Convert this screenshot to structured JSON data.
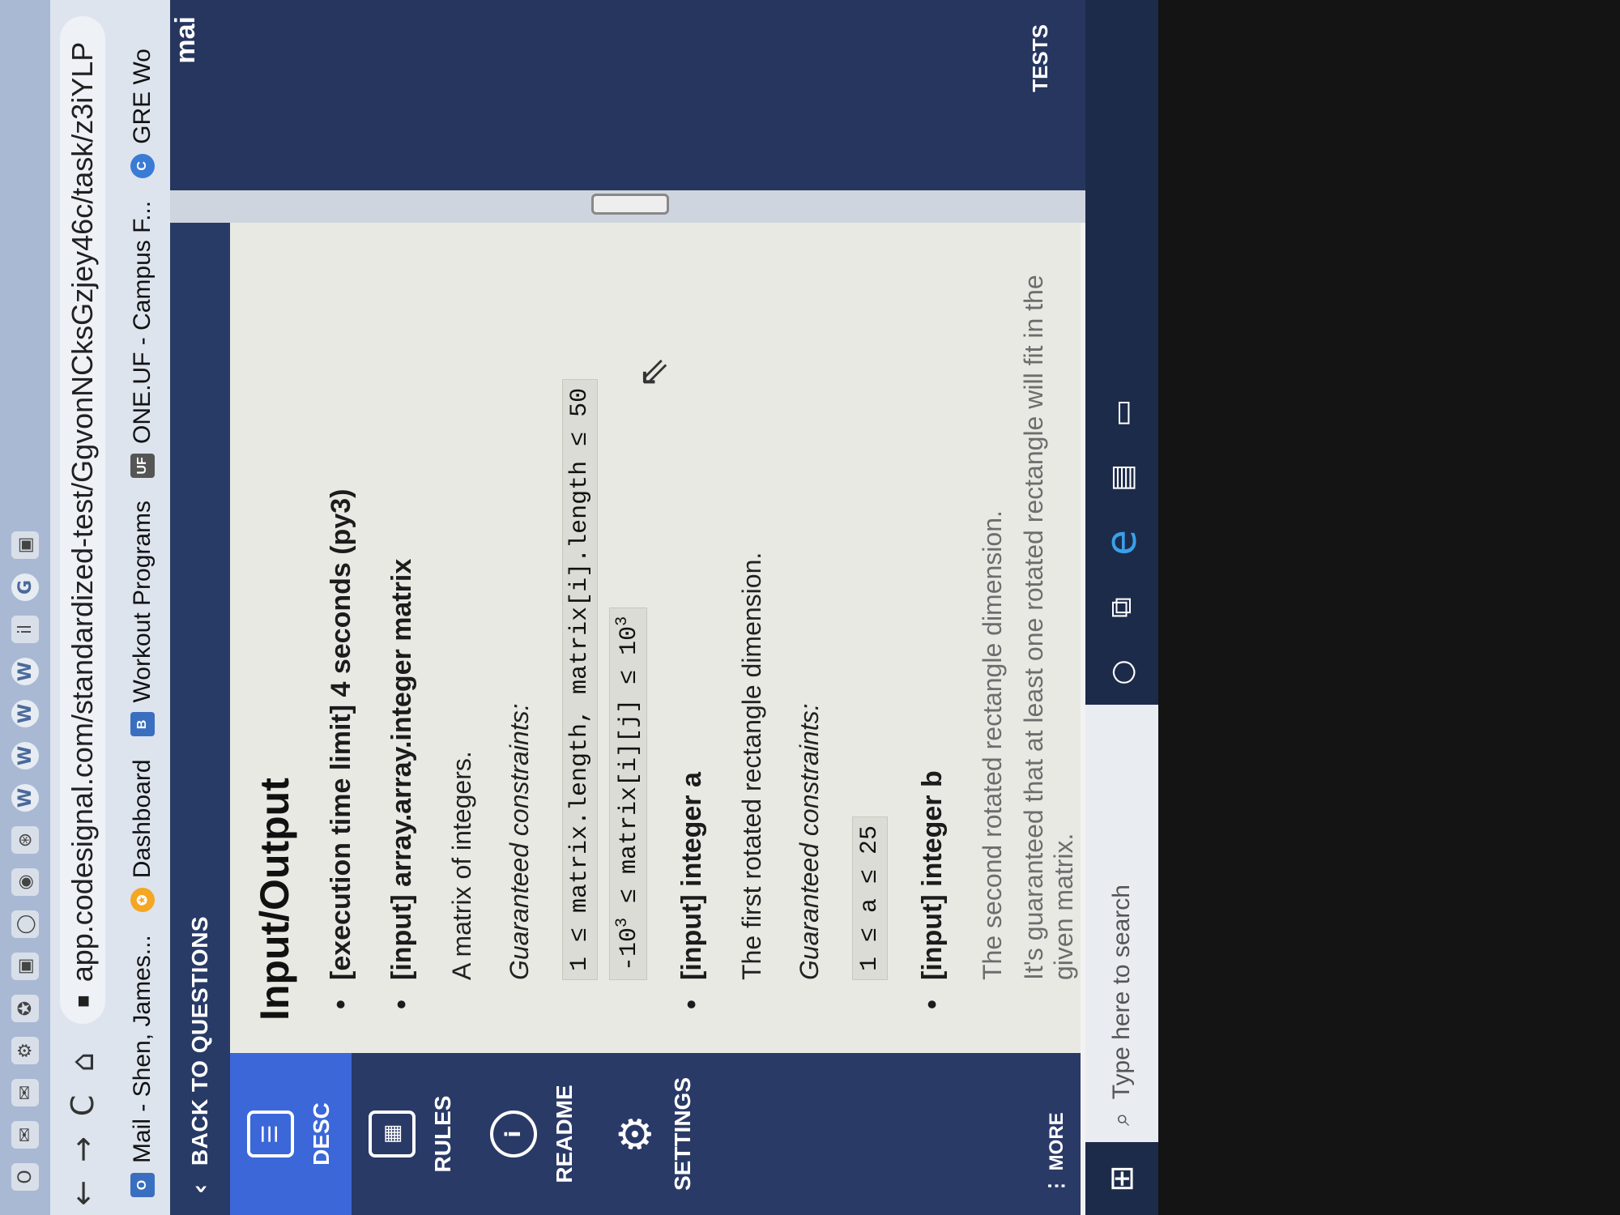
{
  "tabs": [
    "O",
    "✉",
    "✉",
    "⚙",
    "✪",
    "▣",
    "◯",
    "◉",
    "⊛",
    "W",
    "W",
    "W",
    "W",
    "il",
    "G",
    "▣"
  ],
  "toolbar": {
    "back": "←",
    "forward": "→",
    "reload": "C",
    "home": "⌂",
    "url": "app.codesignal.com/standardized-test/GgvonNCksGzjey46c/task/z3iYLP"
  },
  "bookmarks": [
    {
      "icon": "O",
      "label": "Mail - Shen, James..."
    },
    {
      "icon": "✪",
      "label": "Dashboard"
    },
    {
      "icon": "B",
      "label": "Workout Programs"
    },
    {
      "icon": "UF",
      "label": "ONE.UF - Campus F..."
    },
    {
      "icon": "C",
      "label": "GRE Wo"
    }
  ],
  "back_label": "BACK TO QUESTIONS",
  "sidebar": {
    "items": [
      {
        "label": "DESC",
        "icon": "☰"
      },
      {
        "label": "RULES",
        "icon": "▦"
      },
      {
        "label": "README",
        "icon": "i"
      },
      {
        "label": "SETTINGS",
        "icon": "⚙"
      }
    ],
    "more": "⋮ MORE"
  },
  "content": {
    "title": "Input/Output",
    "exec_limit": "[execution time limit] 4 seconds (py3)",
    "input_matrix": "[input] array.array.integer matrix",
    "matrix_desc": "A matrix of integers.",
    "constraints_label": "Guaranteed constraints:",
    "matrix_c1": "1 ≤ matrix.length, matrix[i].length ≤ 50",
    "matrix_c2_pre": "-10",
    "matrix_c2_mid": " ≤ matrix[i][j] ≤ 10",
    "exp": "3",
    "input_a": "[input] integer a",
    "a_desc": "The first rotated rectangle dimension.",
    "a_constraints_label": "Guaranteed constraints:",
    "a_c1": "1 ≤ a ≤ 25",
    "input_b": "[input] integer b",
    "b_desc": "The second rotated rectangle dimension.",
    "b_desc2": "It's guaranteed that at least one rotated rectangle will fit in the given matrix."
  },
  "right_pane": {
    "tab": "mai",
    "tests": "TESTS"
  },
  "taskbar": {
    "search_placeholder": "Type here to search"
  }
}
